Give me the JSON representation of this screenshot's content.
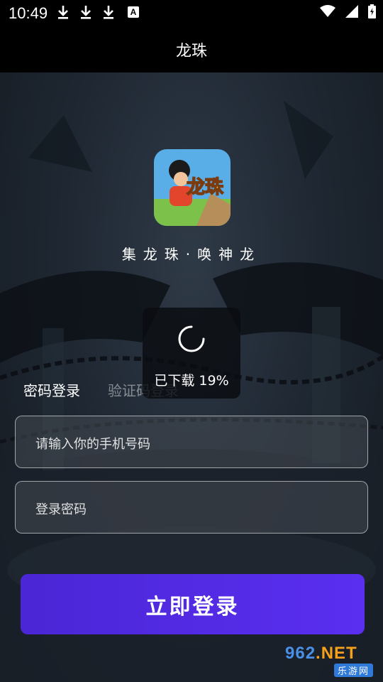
{
  "status_bar": {
    "time": "10:49",
    "left_icons": [
      "download-icon",
      "download-icon",
      "download-icon",
      "a-notification-icon"
    ],
    "a_letter": "A",
    "right_icons": [
      "wifi-icon",
      "signal-icon",
      "battery-charging-icon"
    ]
  },
  "header": {
    "title": "龙珠"
  },
  "game": {
    "name": "集龙珠·唤神龙",
    "icon": "dragon-ball-game-icon"
  },
  "loading": {
    "text": "已下载 19%",
    "progress_percent": 19
  },
  "tabs": [
    {
      "label": "密码登录",
      "active": true
    },
    {
      "label": "验证码登录",
      "active": false
    }
  ],
  "form": {
    "phone_placeholder": "请输入你的手机号码",
    "password_placeholder": "登录密码"
  },
  "login_button": {
    "label": "立即登录",
    "color": "#5029e6"
  },
  "watermark": {
    "brand_a": "962",
    "brand_b": ".NET",
    "sub": "乐游网"
  }
}
